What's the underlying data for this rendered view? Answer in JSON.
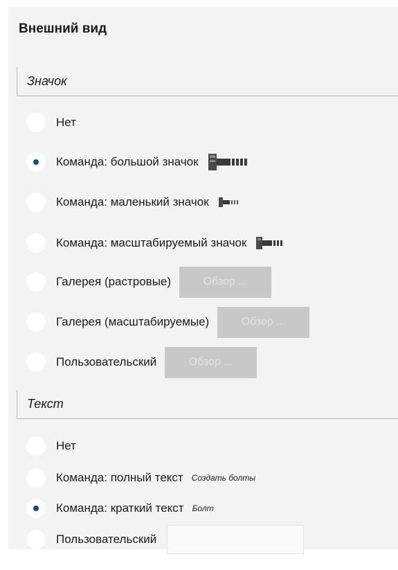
{
  "section_title": "Внешний вид",
  "icon_group": {
    "heading": "Значок",
    "options": [
      {
        "label": "Нет",
        "selected": false
      },
      {
        "label": "Команда: большой значок",
        "selected": true,
        "icon": "bolt-large-icon"
      },
      {
        "label": "Команда: маленький значок",
        "selected": false,
        "icon": "bolt-small-icon"
      },
      {
        "label": "Команда: масштабируемый значок",
        "selected": false,
        "icon": "bolt-scalable-icon"
      },
      {
        "label": "Галерея (растровые)",
        "selected": false,
        "button": "Обзор ..."
      },
      {
        "label": "Галерея (масштабируемые)",
        "selected": false,
        "button": "Обзор ..."
      },
      {
        "label": "Пользовательский",
        "selected": false,
        "button": "Обзор ..."
      }
    ]
  },
  "text_group": {
    "heading": "Текст",
    "options": [
      {
        "label": "Нет",
        "selected": false
      },
      {
        "label": "Команда: полный текст",
        "selected": false,
        "hint": "Создать болты"
      },
      {
        "label": "Команда: краткий текст",
        "selected": true,
        "hint": "Болт"
      },
      {
        "label": "Пользовательский",
        "selected": false,
        "input_value": ""
      }
    ]
  },
  "colors": {
    "panel_bg": "#f3f3f3",
    "radio_dot": "#0a4f8f",
    "button_disabled_bg": "#c8c8c8",
    "button_disabled_text": "#e3e3e3"
  }
}
